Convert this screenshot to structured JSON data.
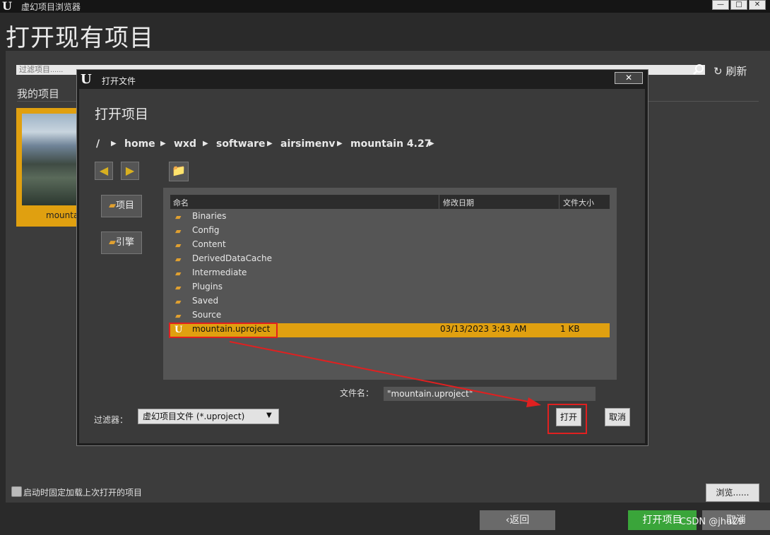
{
  "window": {
    "title": "虚幻项目浏览器",
    "logo": "U",
    "minimize": "—",
    "maximize": "□",
    "close": "✕"
  },
  "page_title": "打开现有项目",
  "search": {
    "placeholder": "过滤项目......",
    "icon": "search-icon"
  },
  "refresh_label": "刷新",
  "my_projects_label": "我的项目",
  "project_card": {
    "name": "mounta"
  },
  "pin_label": "启动时固定加载上次打开的项目",
  "browse_label": "浏览......",
  "bottom": {
    "back": "返回",
    "open_project": "打开项目",
    "cancel": "取消"
  },
  "watermark": "CSDN @jhu​​​29",
  "dialog": {
    "title": "打开文件",
    "logo": "U",
    "close": "✕",
    "heading": "打开项目",
    "breadcrumb": [
      "/",
      "home",
      "wxd",
      "software",
      "airsimenv",
      "mountain 4.27"
    ],
    "back_arrow": "◀",
    "forward_arrow": "▶",
    "new_folder": "📁",
    "side_buttons": [
      "项目",
      "引擎"
    ],
    "columns": [
      "命名",
      "修改日期",
      "文件大小"
    ],
    "folders": [
      "Binaries",
      "Config",
      "Content",
      "DerivedDataCache",
      "Intermediate",
      "Plugins",
      "Saved",
      "Source"
    ],
    "selected_file": {
      "name": "mountain.uproject",
      "date": "03/13/2023  3:43 AM",
      "size": "1 KB"
    },
    "filename_label": "文件名：",
    "filename_value": "\"mountain.uproject\"",
    "filter_label": "过滤器：",
    "filter_value": "虚幻项目文件 (*.uproject)",
    "open": "打开",
    "cancel": "取消"
  },
  "colors": {
    "accent": "#e0a010",
    "green": "#3aa53a",
    "highlight_red": "#e02020"
  }
}
